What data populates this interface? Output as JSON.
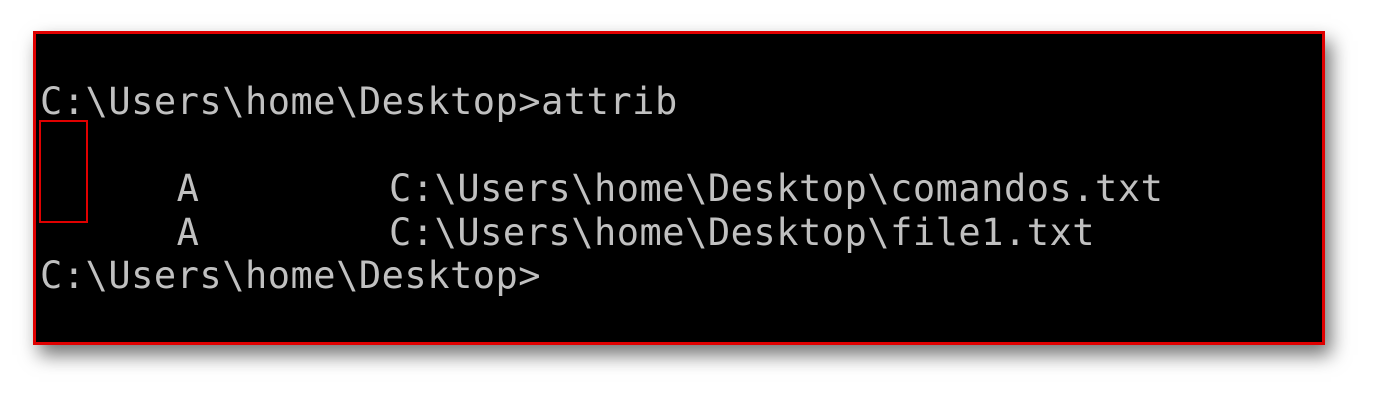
{
  "colors": {
    "console_background": "#000000",
    "console_text": "#c0c0c0",
    "highlight_border": "#e00000"
  },
  "console": {
    "command_line": "C:\\Users\\home\\Desktop>attrib",
    "rows": [
      {
        "attribute": "A",
        "path": "C:\\Users\\home\\Desktop\\comandos.txt"
      },
      {
        "attribute": "A",
        "path": "C:\\Users\\home\\Desktop\\file1.txt"
      }
    ],
    "prompt": "C:\\Users\\home\\Desktop>"
  }
}
